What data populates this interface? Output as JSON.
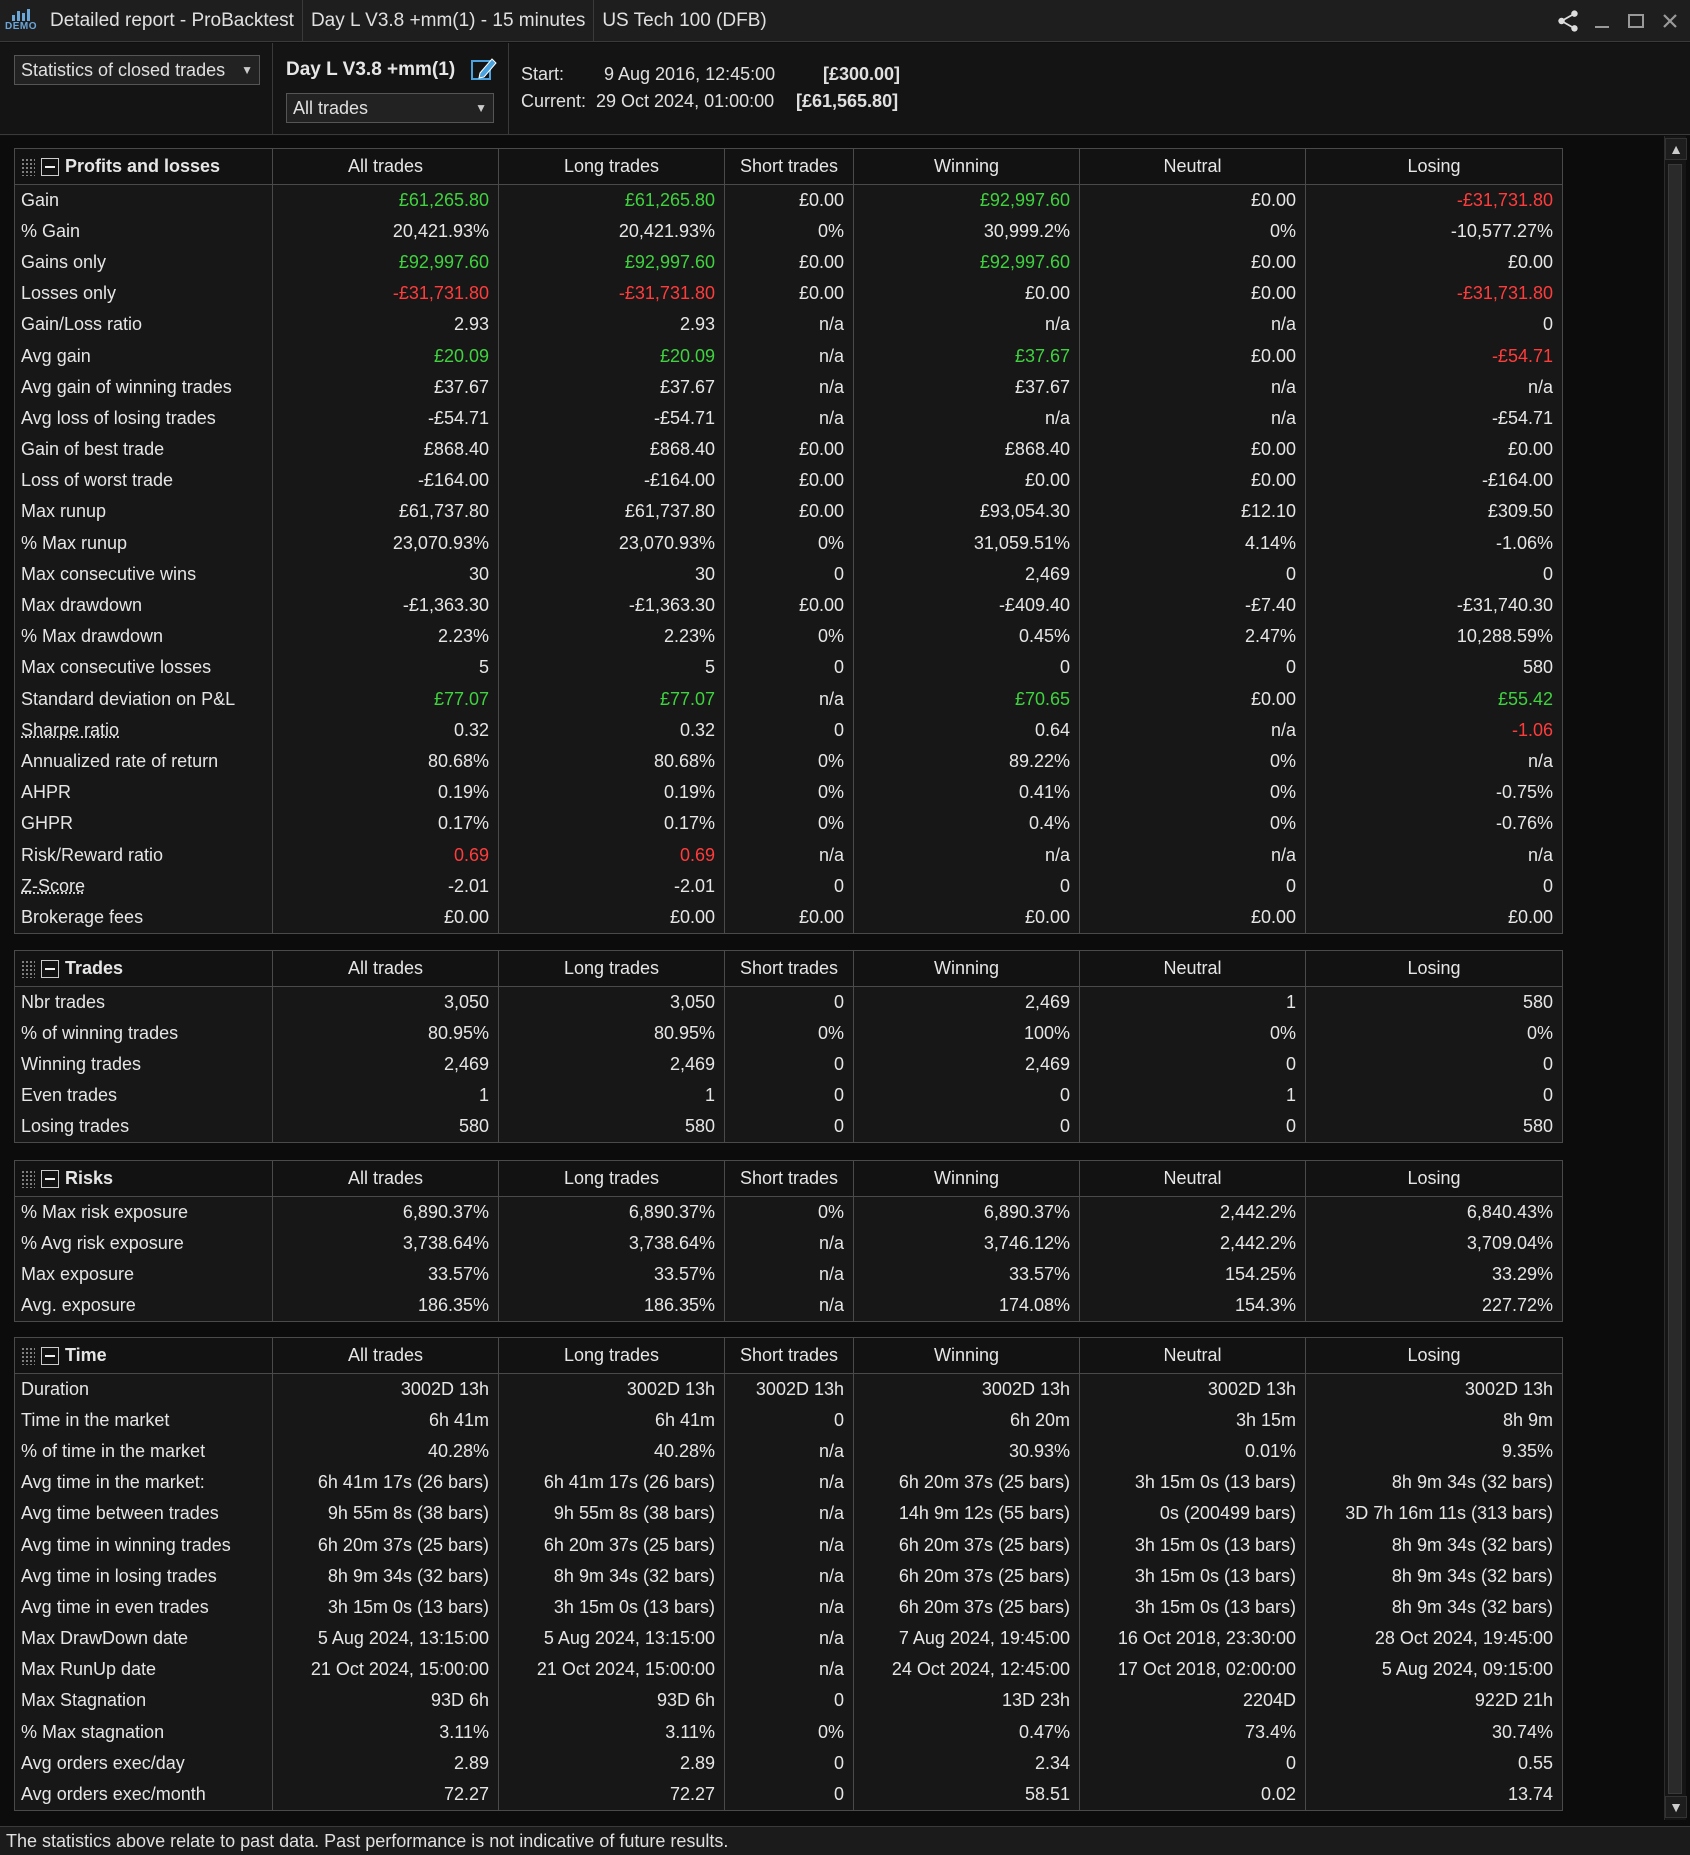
{
  "titlebar": {
    "logo_text": "DEMO",
    "segments": [
      "Detailed report - ProBacktest",
      "Day L V3.8 +mm(1) - 15 minutes",
      "US Tech 100 (DFB)"
    ]
  },
  "header": {
    "view_select": "Statistics of closed trades",
    "strategy_name": "Day L V3.8 +mm(1)",
    "trade_filter": "All trades",
    "start_label": "Start:",
    "start_date": "9 Aug 2016, 12:45:00",
    "start_capital": "[£300.00]",
    "current_label": "Current:",
    "current_date": "29 Oct 2024, 01:00:00",
    "current_capital": "[£61,565.80]"
  },
  "columns": [
    "All trades",
    "Long trades",
    "Short trades",
    "Winning",
    "Neutral",
    "Losing"
  ],
  "sections": [
    {
      "title": "Profits and losses",
      "top": 0,
      "rows": [
        {
          "label": "Gain",
          "values": [
            "£61,265.80",
            "£61,265.80",
            "£0.00",
            "£92,997.60",
            "£0.00",
            "-£31,731.80"
          ],
          "colors": [
            "pos",
            "pos",
            "",
            "pos",
            "",
            "neg"
          ]
        },
        {
          "label": "% Gain",
          "values": [
            "20,421.93%",
            "20,421.93%",
            "0%",
            "30,999.2%",
            "0%",
            "-10,577.27%"
          ]
        },
        {
          "label": "Gains only",
          "values": [
            "£92,997.60",
            "£92,997.60",
            "£0.00",
            "£92,997.60",
            "£0.00",
            "£0.00"
          ],
          "colors": [
            "pos",
            "pos",
            "",
            "pos",
            "",
            ""
          ]
        },
        {
          "label": "Losses only",
          "values": [
            "-£31,731.80",
            "-£31,731.80",
            "£0.00",
            "£0.00",
            "£0.00",
            "-£31,731.80"
          ],
          "colors": [
            "neg",
            "neg",
            "",
            "",
            "",
            "neg"
          ]
        },
        {
          "label": "Gain/Loss ratio",
          "values": [
            "2.93",
            "2.93",
            "n/a",
            "n/a",
            "n/a",
            "0"
          ]
        },
        {
          "label": "Avg gain",
          "values": [
            "£20.09",
            "£20.09",
            "n/a",
            "£37.67",
            "£0.00",
            "-£54.71"
          ],
          "colors": [
            "pos",
            "pos",
            "",
            "pos",
            "",
            "neg"
          ]
        },
        {
          "label": "Avg gain of winning trades",
          "values": [
            "£37.67",
            "£37.67",
            "n/a",
            "£37.67",
            "n/a",
            "n/a"
          ]
        },
        {
          "label": "Avg loss of losing trades",
          "values": [
            "-£54.71",
            "-£54.71",
            "n/a",
            "n/a",
            "n/a",
            "-£54.71"
          ]
        },
        {
          "label": "Gain of best trade",
          "values": [
            "£868.40",
            "£868.40",
            "£0.00",
            "£868.40",
            "£0.00",
            "£0.00"
          ]
        },
        {
          "label": "Loss of worst trade",
          "values": [
            "-£164.00",
            "-£164.00",
            "£0.00",
            "£0.00",
            "£0.00",
            "-£164.00"
          ]
        },
        {
          "label": "Max runup",
          "values": [
            "£61,737.80",
            "£61,737.80",
            "£0.00",
            "£93,054.30",
            "£12.10",
            "£309.50"
          ]
        },
        {
          "label": "% Max runup",
          "values": [
            "23,070.93%",
            "23,070.93%",
            "0%",
            "31,059.51%",
            "4.14%",
            "-1.06%"
          ]
        },
        {
          "label": "Max consecutive wins",
          "values": [
            "30",
            "30",
            "0",
            "2,469",
            "0",
            "0"
          ]
        },
        {
          "label": "Max drawdown",
          "values": [
            "-£1,363.30",
            "-£1,363.30",
            "£0.00",
            "-£409.40",
            "-£7.40",
            "-£31,740.30"
          ]
        },
        {
          "label": "% Max drawdown",
          "values": [
            "2.23%",
            "2.23%",
            "0%",
            "0.45%",
            "2.47%",
            "10,288.59%"
          ]
        },
        {
          "label": "Max consecutive losses",
          "values": [
            "5",
            "5",
            "0",
            "0",
            "0",
            "580"
          ]
        },
        {
          "label": "Standard deviation on P&L",
          "values": [
            "£77.07",
            "£77.07",
            "n/a",
            "£70.65",
            "£0.00",
            "£55.42"
          ],
          "colors": [
            "pos",
            "pos",
            "",
            "pos",
            "",
            "pos"
          ]
        },
        {
          "label": "Sharpe ratio",
          "underline": true,
          "values": [
            "0.32",
            "0.32",
            "0",
            "0.64",
            "n/a",
            "-1.06"
          ],
          "colors": [
            "",
            "",
            "",
            "",
            "",
            "neg"
          ]
        },
        {
          "label": "Annualized rate of return",
          "values": [
            "80.68%",
            "80.68%",
            "0%",
            "89.22%",
            "0%",
            "n/a"
          ]
        },
        {
          "label": "AHPR",
          "values": [
            "0.19%",
            "0.19%",
            "0%",
            "0.41%",
            "0%",
            "-0.75%"
          ]
        },
        {
          "label": "GHPR",
          "values": [
            "0.17%",
            "0.17%",
            "0%",
            "0.4%",
            "0%",
            "-0.76%"
          ]
        },
        {
          "label": "Risk/Reward ratio",
          "values": [
            "0.69",
            "0.69",
            "n/a",
            "n/a",
            "n/a",
            "n/a"
          ],
          "colors": [
            "neg",
            "neg",
            "",
            "",
            "",
            ""
          ]
        },
        {
          "label": "Z-Score",
          "underline": true,
          "values": [
            "-2.01",
            "-2.01",
            "0",
            "0",
            "0",
            "0"
          ]
        },
        {
          "label": "Brokerage fees",
          "values": [
            "£0.00",
            "£0.00",
            "£0.00",
            "£0.00",
            "£0.00",
            "£0.00"
          ]
        }
      ]
    },
    {
      "title": "Trades",
      "rows": [
        {
          "label": "Nbr trades",
          "values": [
            "3,050",
            "3,050",
            "0",
            "2,469",
            "1",
            "580"
          ]
        },
        {
          "label": "% of winning trades",
          "values": [
            "80.95%",
            "80.95%",
            "0%",
            "100%",
            "0%",
            "0%"
          ]
        },
        {
          "label": "Winning trades",
          "values": [
            "2,469",
            "2,469",
            "0",
            "2,469",
            "0",
            "0"
          ]
        },
        {
          "label": "Even trades",
          "values": [
            "1",
            "1",
            "0",
            "0",
            "1",
            "0"
          ]
        },
        {
          "label": "Losing trades",
          "values": [
            "580",
            "580",
            "0",
            "0",
            "0",
            "580"
          ]
        }
      ]
    },
    {
      "title": "Risks",
      "rows": [
        {
          "label": "% Max risk exposure",
          "values": [
            "6,890.37%",
            "6,890.37%",
            "0%",
            "6,890.37%",
            "2,442.2%",
            "6,840.43%"
          ]
        },
        {
          "label": "% Avg risk exposure",
          "values": [
            "3,738.64%",
            "3,738.64%",
            "n/a",
            "3,746.12%",
            "2,442.2%",
            "3,709.04%"
          ]
        },
        {
          "label": "Max exposure",
          "values": [
            "33.57%",
            "33.57%",
            "n/a",
            "33.57%",
            "154.25%",
            "33.29%"
          ]
        },
        {
          "label": "Avg. exposure",
          "values": [
            "186.35%",
            "186.35%",
            "n/a",
            "174.08%",
            "154.3%",
            "227.72%"
          ]
        }
      ]
    },
    {
      "title": "Time",
      "rows": [
        {
          "label": "Duration",
          "values": [
            "3002D 13h",
            "3002D 13h",
            "3002D 13h",
            "3002D 13h",
            "3002D 13h",
            "3002D 13h"
          ]
        },
        {
          "label": "Time in the market",
          "values": [
            "6h 41m",
            "6h 41m",
            "0",
            "6h 20m",
            "3h 15m",
            "8h 9m"
          ]
        },
        {
          "label": "% of time in the market",
          "values": [
            "40.28%",
            "40.28%",
            "n/a",
            "30.93%",
            "0.01%",
            "9.35%"
          ]
        },
        {
          "label": "Avg time in the market:",
          "values": [
            "6h 41m 17s (26 bars)",
            "6h 41m 17s (26 bars)",
            "n/a",
            "6h 20m 37s (25 bars)",
            "3h 15m 0s (13 bars)",
            "8h 9m 34s (32 bars)"
          ]
        },
        {
          "label": "Avg time between trades",
          "values": [
            "9h 55m 8s (38 bars)",
            "9h 55m 8s (38 bars)",
            "n/a",
            "14h 9m 12s (55 bars)",
            "0s (200499 bars)",
            "3D 7h 16m 11s (313 bars)"
          ]
        },
        {
          "label": "Avg time in winning trades",
          "values": [
            "6h 20m 37s (25 bars)",
            "6h 20m 37s (25 bars)",
            "n/a",
            "6h 20m 37s (25 bars)",
            "3h 15m 0s (13 bars)",
            "8h 9m 34s (32 bars)"
          ]
        },
        {
          "label": "Avg time in losing trades",
          "values": [
            "8h 9m 34s (32 bars)",
            "8h 9m 34s (32 bars)",
            "n/a",
            "6h 20m 37s (25 bars)",
            "3h 15m 0s (13 bars)",
            "8h 9m 34s (32 bars)"
          ]
        },
        {
          "label": "Avg time in even trades",
          "values": [
            "3h 15m 0s (13 bars)",
            "3h 15m 0s (13 bars)",
            "n/a",
            "6h 20m 37s (25 bars)",
            "3h 15m 0s (13 bars)",
            "8h 9m 34s (32 bars)"
          ]
        },
        {
          "label": "Max DrawDown date",
          "values": [
            "5 Aug 2024, 13:15:00",
            "5 Aug 2024, 13:15:00",
            "n/a",
            "7 Aug 2024, 19:45:00",
            "16 Oct 2018, 23:30:00",
            "28 Oct 2024, 19:45:00"
          ]
        },
        {
          "label": "Max RunUp date",
          "values": [
            "21 Oct 2024, 15:00:00",
            "21 Oct 2024, 15:00:00",
            "n/a",
            "24 Oct 2024, 12:45:00",
            "17 Oct 2018, 02:00:00",
            "5 Aug 2024, 09:15:00"
          ]
        },
        {
          "label": "Max Stagnation",
          "values": [
            "93D 6h",
            "93D 6h",
            "0",
            "13D 23h",
            "2204D",
            "922D 21h"
          ]
        },
        {
          "label": "% Max stagnation",
          "values": [
            "3.11%",
            "3.11%",
            "0%",
            "0.47%",
            "73.4%",
            "30.74%"
          ]
        },
        {
          "label": "Avg orders exec/day",
          "values": [
            "2.89",
            "2.89",
            "0",
            "2.34",
            "0",
            "0.55"
          ]
        },
        {
          "label": "Avg orders exec/month",
          "values": [
            "72.27",
            "72.27",
            "0",
            "58.51",
            "0.02",
            "13.74"
          ]
        }
      ]
    }
  ],
  "footer": "The statistics above relate to past data. Past performance is not indicative of future results."
}
